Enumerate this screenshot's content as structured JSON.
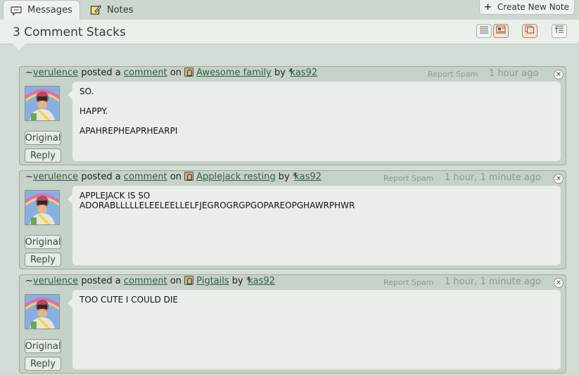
{
  "tabs": {
    "messages": "Messages",
    "notes": "Notes"
  },
  "create_note": "Create New Note",
  "page_title": "3 Comment Stacks",
  "view_buttons": [
    "list-view-icon",
    "detail-view-icon",
    "stack-view-icon",
    "sort-icon"
  ],
  "colors": {
    "background": "#d4ddd5",
    "link": "#35604a",
    "muted": "#8f9a90",
    "selected_view": "#f5e3d6"
  },
  "actions": {
    "original": "Original",
    "reply": "Reply",
    "report_spam": "Report Spam"
  },
  "comments": [
    {
      "user_prefix": "~",
      "user": "verulence",
      "verb": "posted a",
      "object": "comment",
      "prep": "on",
      "deviation": "Awesome family",
      "by": "by",
      "author_prefix": "*",
      "author": "kas92",
      "time": "1 hour ago",
      "body": [
        "SO.",
        "HAPPY.",
        "APAHREPHEAPRHEARPI"
      ]
    },
    {
      "user_prefix": "~",
      "user": "verulence",
      "verb": "posted a",
      "object": "comment",
      "prep": "on",
      "deviation": "Applejack resting",
      "by": "by",
      "author_prefix": "*",
      "author": "kas92",
      "time": "1 hour, 1 minute ago",
      "body": [
        "APPLEJACK IS SO",
        "ADORABLLLLLELEELEELLELFJEGROGRGPGOPAREOPGHAWRPHWR"
      ]
    },
    {
      "user_prefix": "~",
      "user": "verulence",
      "verb": "posted a",
      "object": "comment",
      "prep": "on",
      "deviation": "Pigtails",
      "by": "by",
      "author_prefix": "*",
      "author": "kas92",
      "time": "1 hour, 1 minute ago",
      "body": [
        "TOO CUTE I COULD DIE"
      ]
    }
  ]
}
